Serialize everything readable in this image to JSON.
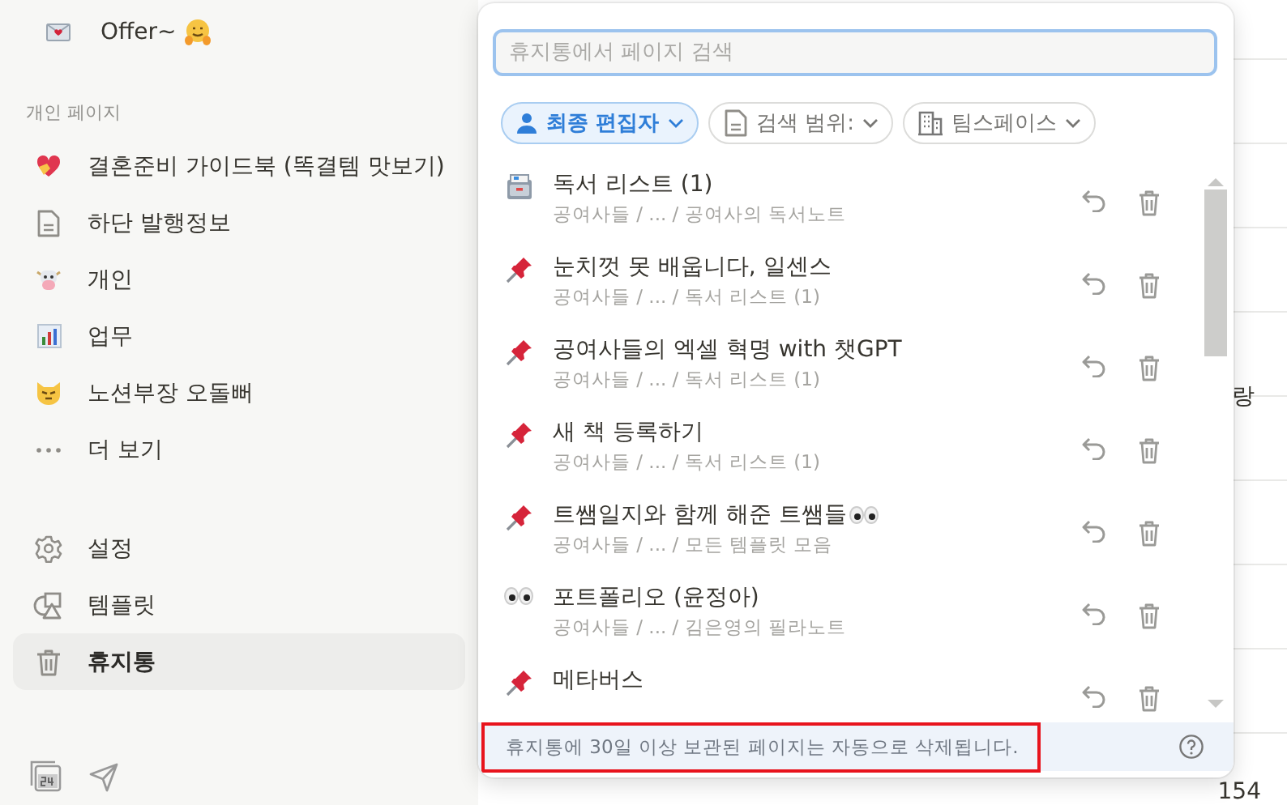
{
  "sidebar": {
    "workspace": {
      "kind": "envelope",
      "title": "Offer~"
    },
    "section_label": "개인 페이지",
    "pages": [
      {
        "kind": "heart",
        "label": "결혼준비 가이드북 (똑결템 맛보기)"
      },
      {
        "kind": "doc",
        "label": "하단 발행정보"
      },
      {
        "kind": "cow",
        "label": "개인"
      },
      {
        "kind": "chart",
        "label": "업무"
      },
      {
        "kind": "cat",
        "label": "노션부장 오돌뻐"
      },
      {
        "kind": "dots",
        "label": "더 보기"
      }
    ],
    "tools": [
      {
        "kind": "gear",
        "label": "설정",
        "selected": false
      },
      {
        "kind": "shapes",
        "label": "템플릿",
        "selected": false
      },
      {
        "kind": "trash",
        "label": "휴지통",
        "selected": true
      }
    ]
  },
  "trash_panel": {
    "search": {
      "placeholder": "휴지통에서 페이지 검색"
    },
    "filters": [
      {
        "kind": "person",
        "label": "최종 편집자",
        "selected": true
      },
      {
        "kind": "doc",
        "label": "검색 범위:",
        "selected": false
      },
      {
        "kind": "building",
        "label": "팀스페이스",
        "selected": false
      }
    ],
    "pages": [
      {
        "kind": "cabinet",
        "title": "독서 리스트 (1)",
        "path": "공여사들 / ... / 공여사의 독서노트"
      },
      {
        "kind": "pin",
        "title": "눈치껏 못 배웁니다, 일센스",
        "path": "공여사들 / ... / 독서 리스트 (1)"
      },
      {
        "kind": "pin",
        "title": "공여사들의 엑셀 혁명 with 챗GPT",
        "path": "공여사들 / ... / 독서 리스트 (1)"
      },
      {
        "kind": "pin",
        "title": "새 책 등록하기",
        "path": "공여사들 / ... / 독서 리스트 (1)"
      },
      {
        "kind": "pin-eyes",
        "title": "트쌤일지와 함께 해준 트쌤들",
        "path": "공여사들 / ... / 모든 템플릿 모음"
      },
      {
        "kind": "eyes",
        "title": "포트폴리오 (윤정아)",
        "path": "공여사들 / ... / 김은영의 필라노트"
      },
      {
        "kind": "pin",
        "title": "메타버스"
      }
    ],
    "footer": "휴지통에 30일 이상 보관된 페이지는 자동으로 삭제됩니다."
  },
  "background_page": {
    "fragment": "랑",
    "count": "154"
  }
}
